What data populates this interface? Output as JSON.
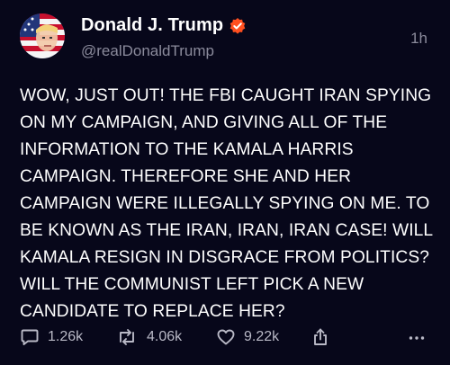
{
  "author": {
    "display_name": "Donald J. Trump",
    "handle": "@realDonaldTrump",
    "verified": true
  },
  "timestamp": "1h",
  "post": {
    "text": "WOW, JUST OUT! THE FBI CAUGHT IRAN SPYING\nON MY CAMPAIGN, AND GIVING ALL OF THE\nINFORMATION TO THE KAMALA HARRIS\nCAMPAIGN. THEREFORE SHE AND HER\nCAMPAIGN WERE ILLEGALLY SPYING ON ME. TO\nBE KNOWN AS THE IRAN, IRAN, IRAN CASE! WILL\nKAMALA RESIGN IN DISGRACE FROM POLITICS?\nWILL THE COMMUNIST LEFT PICK A NEW\nCANDIDATE TO REPLACE HER?"
  },
  "actions": {
    "replies": "1.26k",
    "reposts": "4.06k",
    "likes": "9.22k"
  },
  "icons": {
    "reply": "reply-bubble-icon",
    "repost": "repost-arrows-icon",
    "like": "heart-icon",
    "share": "share-upload-icon",
    "more": "more-dots-icon",
    "verified": "verified-badge-icon"
  },
  "colors": {
    "background": "#07071a",
    "text": "#ffffff",
    "secondary_text": "#8b8b9c",
    "verified_badge": "#ff4f1f"
  }
}
